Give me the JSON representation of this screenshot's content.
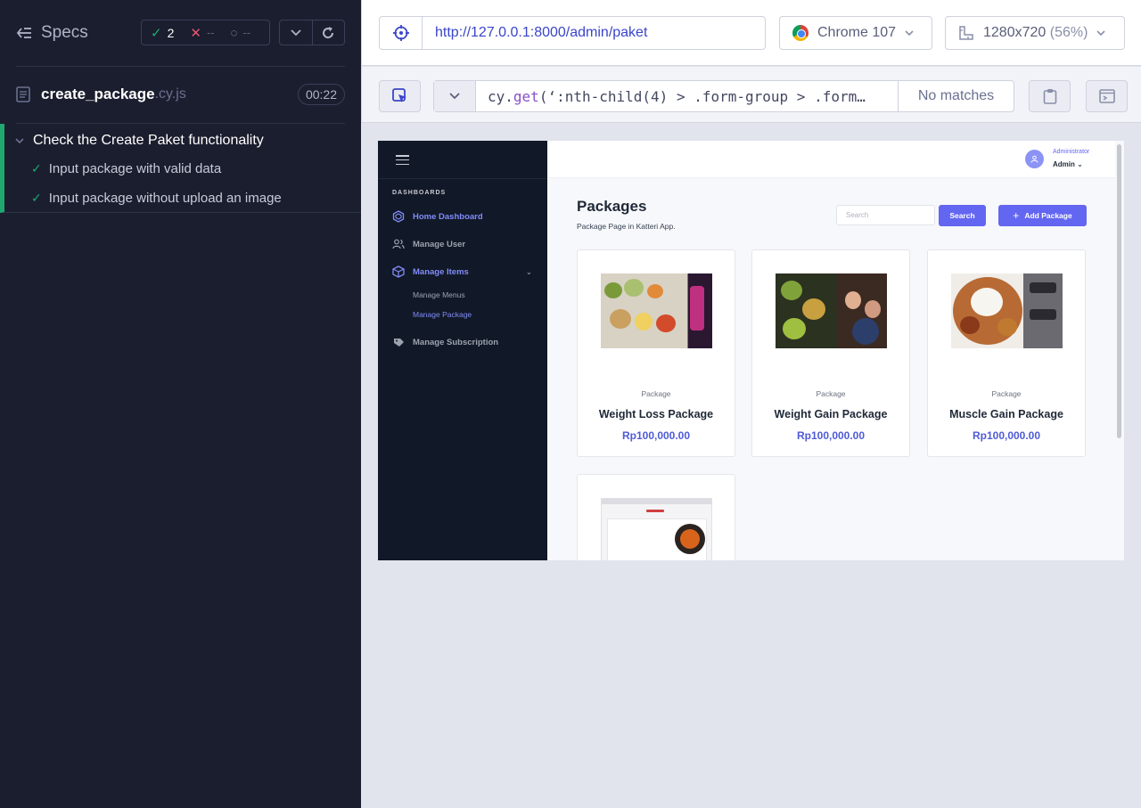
{
  "reporter": {
    "specs_label": "Specs",
    "passed": "2",
    "failed": "--",
    "pending": "--",
    "spec_name": "create_package",
    "spec_ext": ".cy.js",
    "duration": "00:22",
    "suite_title": "Check the Create Paket functionality",
    "tests": [
      {
        "title": "Input package with valid data",
        "state": "passed"
      },
      {
        "title": "Input package without upload an image",
        "state": "passed"
      }
    ]
  },
  "topbar": {
    "url": "http://127.0.0.1:8000/admin/paket",
    "browser": "Chrome 107",
    "viewport": "1280x720",
    "zoom": "(56%)"
  },
  "selector_playground": {
    "command": "cy.get(‘:nth-child(4) > .form-group > .form…",
    "command_prefix": "cy.",
    "command_fn": "get",
    "command_arg": "(‘:nth-child(4) > .form-group > .form…",
    "match_status": "No matches"
  },
  "app": {
    "sidebar": {
      "section_label": "DASHBOARDS",
      "items": [
        {
          "label": "Home Dashboard",
          "active": true,
          "icon": "dashboard-icon"
        },
        {
          "label": "Manage User",
          "active": false,
          "icon": "users-icon"
        },
        {
          "label": "Manage Items",
          "active": true,
          "icon": "box-icon"
        },
        {
          "label": "Manage Subscription",
          "active": false,
          "icon": "subscription-icon"
        }
      ],
      "subitems": [
        {
          "label": "Manage Menus",
          "active": false
        },
        {
          "label": "Manage Package",
          "active": true
        }
      ]
    },
    "user": {
      "role": "Administrator",
      "name": "Admin"
    },
    "page": {
      "title": "Packages",
      "subtitle": "Package Page in Katteri App.",
      "search_placeholder": "Search",
      "search_button": "Search",
      "add_button": "Add Package"
    },
    "packages": [
      {
        "type": "Package",
        "name": "Weight Loss Package",
        "price": "Rp100,000.00"
      },
      {
        "type": "Package",
        "name": "Weight Gain Package",
        "price": "Rp100,000.00"
      },
      {
        "type": "Package",
        "name": "Muscle Gain Package",
        "price": "Rp100,000.00"
      }
    ],
    "accent_color": "#6366f1",
    "sidebar_color": "#111827"
  },
  "colors": {
    "reporter_bg": "#1b1e2e",
    "pass_green": "#1fa971",
    "fail_red": "#e45770",
    "url_blue": "#3a45c8"
  }
}
